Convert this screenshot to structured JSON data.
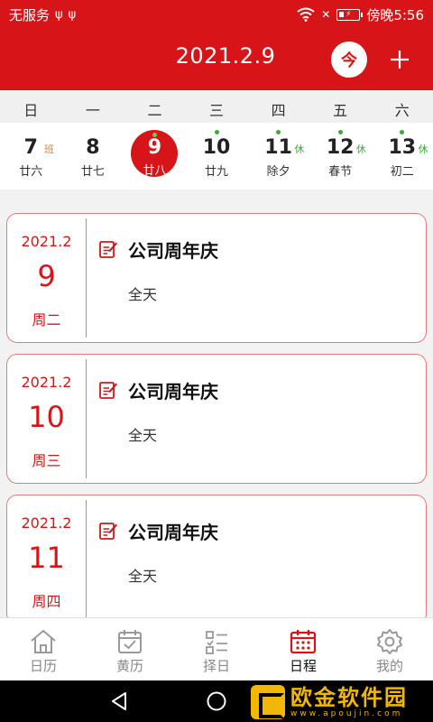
{
  "status_bar": {
    "carrier": "无服务",
    "time": "傍晚5:56"
  },
  "header": {
    "title": "2021.2.9",
    "today_label": "今"
  },
  "weekdays": [
    "日",
    "一",
    "二",
    "三",
    "四",
    "五",
    "六"
  ],
  "days": [
    {
      "num": "7",
      "lunar": "廿六",
      "tag": "班",
      "tag_type": "work",
      "dot": false,
      "selected": false
    },
    {
      "num": "8",
      "lunar": "廿七",
      "tag": "",
      "tag_type": "",
      "dot": false,
      "selected": false
    },
    {
      "num": "9",
      "lunar": "廿八",
      "tag": "",
      "tag_type": "",
      "dot": true,
      "selected": true
    },
    {
      "num": "10",
      "lunar": "廿九",
      "tag": "",
      "tag_type": "",
      "dot": true,
      "selected": false
    },
    {
      "num": "11",
      "lunar": "除夕",
      "tag": "休",
      "tag_type": "rest",
      "dot": true,
      "selected": false
    },
    {
      "num": "12",
      "lunar": "春节",
      "tag": "休",
      "tag_type": "rest",
      "dot": true,
      "selected": false
    },
    {
      "num": "13",
      "lunar": "初二",
      "tag": "休",
      "tag_type": "rest",
      "dot": true,
      "selected": false
    }
  ],
  "events": [
    {
      "year_month": "2021.2",
      "day": "9",
      "weekday": "周二",
      "title": "公司周年庆",
      "time": "全天"
    },
    {
      "year_month": "2021.2",
      "day": "10",
      "weekday": "周三",
      "title": "公司周年庆",
      "time": "全天"
    },
    {
      "year_month": "2021.2",
      "day": "11",
      "weekday": "周四",
      "title": "公司周年庆",
      "time": "全天"
    }
  ],
  "bottom_nav": [
    {
      "label": "日历",
      "icon": "home-icon",
      "active": false
    },
    {
      "label": "黄历",
      "icon": "almanac-icon",
      "active": false
    },
    {
      "label": "择日",
      "icon": "checklist-icon",
      "active": false
    },
    {
      "label": "日程",
      "icon": "schedule-calendar-icon",
      "active": true
    },
    {
      "label": "我的",
      "icon": "gear-icon",
      "active": false
    }
  ],
  "watermark": {
    "name": "欧金软件园",
    "url": "www.apoujin.com"
  },
  "colors": {
    "accent": "#d71518",
    "rest_green": "#3da83d",
    "work_orange": "#e08030"
  }
}
